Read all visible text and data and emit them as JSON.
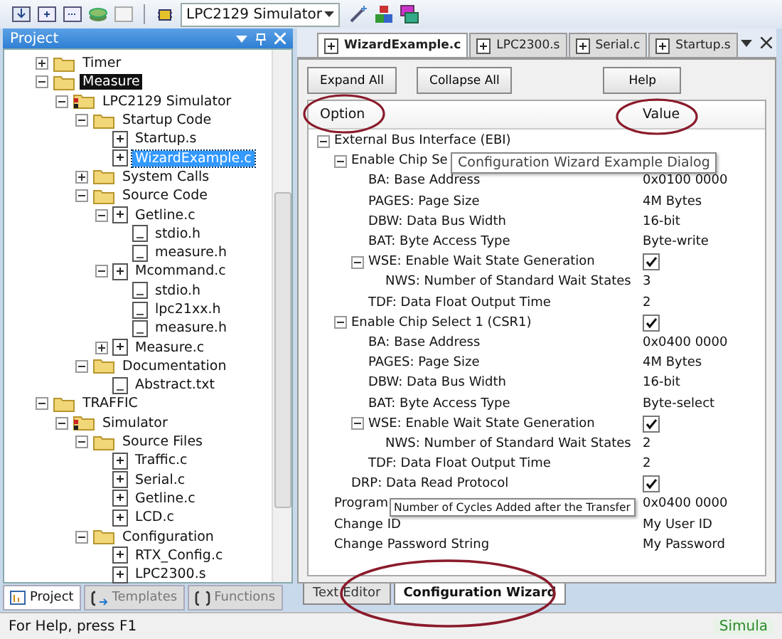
{
  "toolbar": {
    "target": "LPC2129 Simulator"
  },
  "project_panel": {
    "title": "Project",
    "tree": [
      {
        "label": "Timer",
        "kind": "folder",
        "expanded": false,
        "active": false,
        "selected": false
      },
      {
        "label": "Measure",
        "kind": "folder",
        "expanded": true,
        "active": true,
        "selected": false,
        "children": [
          {
            "label": "LPC2129 Simulator",
            "kind": "target",
            "expanded": true,
            "selected": false,
            "children": [
              {
                "label": "Startup Code",
                "kind": "folder",
                "expanded": true,
                "selected": false,
                "children": [
                  {
                    "label": "Startup.s",
                    "kind": "source",
                    "selected": false
                  },
                  {
                    "label": "WizardExample.c",
                    "kind": "source",
                    "selected": true
                  }
                ]
              },
              {
                "label": "System Calls",
                "kind": "folder",
                "expanded": false,
                "selected": false
              },
              {
                "label": "Source Code",
                "kind": "folder",
                "expanded": true,
                "selected": false,
                "children": [
                  {
                    "label": "Getline.c",
                    "kind": "source",
                    "expanded": true,
                    "selected": false,
                    "children": [
                      {
                        "label": "stdio.h",
                        "kind": "header",
                        "selected": false
                      },
                      {
                        "label": "measure.h",
                        "kind": "header",
                        "selected": false
                      }
                    ]
                  },
                  {
                    "label": "Mcommand.c",
                    "kind": "source",
                    "expanded": true,
                    "selected": false,
                    "children": [
                      {
                        "label": "stdio.h",
                        "kind": "header",
                        "selected": false
                      },
                      {
                        "label": "lpc21xx.h",
                        "kind": "header",
                        "selected": false
                      },
                      {
                        "label": "measure.h",
                        "kind": "header",
                        "selected": false
                      }
                    ]
                  },
                  {
                    "label": "Measure.c",
                    "kind": "source",
                    "expanded": false,
                    "selected": false
                  }
                ]
              },
              {
                "label": "Documentation",
                "kind": "folder",
                "expanded": true,
                "selected": false,
                "children": [
                  {
                    "label": "Abstract.txt",
                    "kind": "header",
                    "selected": false
                  }
                ]
              }
            ]
          }
        ]
      },
      {
        "label": "TRAFFIC",
        "kind": "folder",
        "expanded": true,
        "active": false,
        "selected": false,
        "children": [
          {
            "label": "Simulator",
            "kind": "target",
            "expanded": true,
            "selected": false,
            "children": [
              {
                "label": "Source Files",
                "kind": "folder",
                "expanded": true,
                "selected": false,
                "children": [
                  {
                    "label": "Traffic.c",
                    "kind": "source",
                    "selected": false
                  },
                  {
                    "label": "Serial.c",
                    "kind": "source",
                    "selected": false
                  },
                  {
                    "label": "Getline.c",
                    "kind": "source",
                    "selected": false
                  },
                  {
                    "label": "LCD.c",
                    "kind": "source",
                    "selected": false
                  }
                ]
              },
              {
                "label": "Configuration",
                "kind": "folder",
                "expanded": true,
                "selected": false,
                "children": [
                  {
                    "label": "RTX_Config.c",
                    "kind": "source",
                    "selected": false
                  },
                  {
                    "label": "LPC2300.s",
                    "kind": "source",
                    "selected": false
                  }
                ]
              }
            ]
          }
        ]
      }
    ],
    "tabs": [
      {
        "label": "Project",
        "selected": true
      },
      {
        "label": "Templates",
        "selected": false
      },
      {
        "label": "Functions",
        "selected": false
      }
    ]
  },
  "editor": {
    "tabs": [
      {
        "label": "WizardExample.c",
        "selected": true
      },
      {
        "label": "LPC2300.s",
        "selected": false
      },
      {
        "label": "Serial.c",
        "selected": false
      },
      {
        "label": "Startup.s",
        "selected": false
      }
    ],
    "buttons": [
      "Expand All",
      "Collapse All",
      "Help"
    ],
    "columns": [
      "Option",
      "Value"
    ],
    "rows": [
      {
        "label": "External Bus Interface (EBI)",
        "expanded": true,
        "children": [
          {
            "label": "Enable Chip Se",
            "expanded": true,
            "children": [
              {
                "label": "BA: Base Address",
                "kind": "text",
                "value": "0x0100 0000"
              },
              {
                "label": "PAGES: Page Size",
                "kind": "text",
                "value": "4M Bytes"
              },
              {
                "label": "DBW: Data Bus Width",
                "kind": "text",
                "value": "16-bit"
              },
              {
                "label": "BAT: Byte Access Type",
                "kind": "text",
                "value": "Byte-write"
              },
              {
                "label": "WSE: Enable Wait State Generation",
                "kind": "checkbox",
                "checked": true,
                "expanded": true,
                "children": [
                  {
                    "label": "NWS: Number of Standard Wait States",
                    "kind": "text",
                    "value": "3"
                  }
                ]
              },
              {
                "label": "TDF: Data Float Output Time",
                "kind": "text",
                "value": "2"
              }
            ]
          },
          {
            "label": "Enable Chip Select 1 (CSR1)",
            "kind": "checkbox",
            "checked": true,
            "expanded": true,
            "children": [
              {
                "label": "BA: Base Address",
                "kind": "text",
                "value": "0x0400 0000"
              },
              {
                "label": "PAGES: Page Size",
                "kind": "text",
                "value": "4M Bytes"
              },
              {
                "label": "DBW: Data Bus Width",
                "kind": "text",
                "value": "16-bit"
              },
              {
                "label": "BAT: Byte Access Type",
                "kind": "text",
                "value": "Byte-select"
              },
              {
                "label": "WSE: Enable Wait State Generation",
                "kind": "checkbox",
                "checked": true,
                "expanded": true,
                "children": [
                  {
                    "label": "NWS: Number of Standard Wait States",
                    "kind": "text",
                    "value": "2"
                  }
                ]
              },
              {
                "label": "TDF: Data Float Output Time",
                "kind": "text",
                "value": "2"
              }
            ]
          },
          {
            "label": "DRP: Data Read Protocol",
            "kind": "checkbox",
            "checked": true
          }
        ]
      },
      {
        "label": "Program",
        "kind": "text",
        "value": "0x0400 0000"
      },
      {
        "label": "Change ID",
        "kind": "text",
        "value": "My User ID"
      },
      {
        "label": "Change Password String",
        "kind": "text",
        "value": "My Password"
      }
    ],
    "tooltips": [
      "Configuration Wizard Example Dialog",
      "Number of Cycles Added after the Transfer"
    ],
    "bottom_tabs": [
      {
        "label": "Text Editor",
        "selected": false
      },
      {
        "label": "Configuration Wizard",
        "selected": true
      }
    ]
  },
  "status_bar": {
    "help": "For Help, press F1",
    "mode": "Simula"
  }
}
